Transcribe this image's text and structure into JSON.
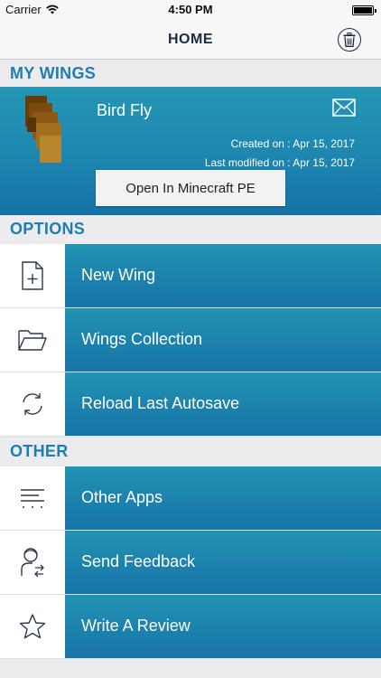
{
  "status": {
    "carrier": "Carrier",
    "time": "4:50 PM"
  },
  "nav": {
    "title": "HOME"
  },
  "sections": {
    "my_wings": "MY WINGS",
    "options": "OPTIONS",
    "other": "OTHER"
  },
  "wing": {
    "name": "Bird Fly",
    "created": "Created on : Apr 15, 2017",
    "modified": "Last modified on : Apr 15, 2017",
    "open_label": "Open In Minecraft PE"
  },
  "options": [
    {
      "label": "New Wing",
      "icon": "new-file-icon"
    },
    {
      "label": "Wings Collection",
      "icon": "folder-icon"
    },
    {
      "label": "Reload Last Autosave",
      "icon": "reload-icon"
    }
  ],
  "other": [
    {
      "label": "Other Apps",
      "icon": "list-icon"
    },
    {
      "label": "Send Feedback",
      "icon": "feedback-icon"
    },
    {
      "label": "Write A Review",
      "icon": "star-icon"
    }
  ],
  "colors": {
    "accent": "#1d7db5",
    "row_bg": "#1c83ad",
    "nav_text": "#1c2b44"
  }
}
